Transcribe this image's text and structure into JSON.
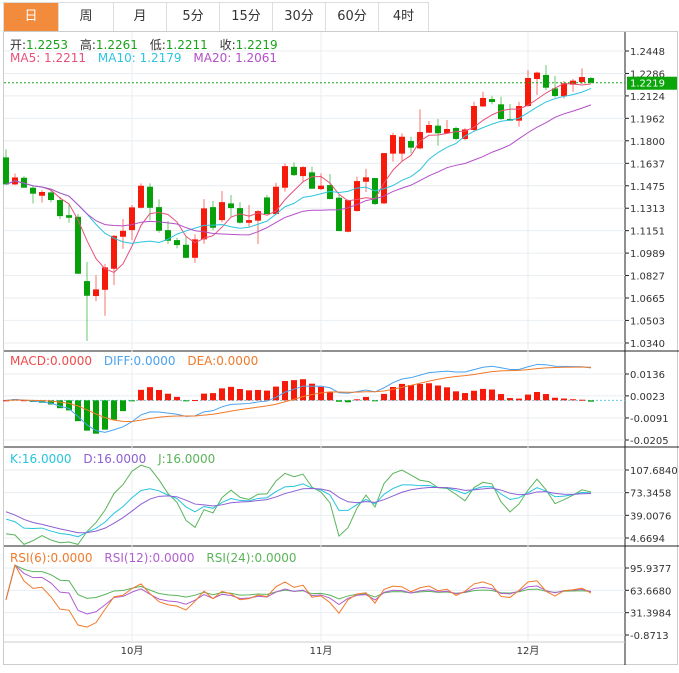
{
  "tabs": [
    {
      "label": "日",
      "active": true
    },
    {
      "label": "周"
    },
    {
      "label": "月"
    },
    {
      "label": "5分"
    },
    {
      "label": "15分"
    },
    {
      "label": "30分"
    },
    {
      "label": "60分"
    },
    {
      "label": "4时"
    }
  ],
  "ohlc_legend": {
    "open_label": "开:",
    "open": "1.2253",
    "high_label": "高:",
    "high": "1.2261",
    "low_label": "低:",
    "low": "1.2211",
    "close_label": "收:",
    "close": "1.2219"
  },
  "ma_legend": {
    "ma5": "MA5: 1.2211",
    "ma10": "MA10: 1.2179",
    "ma20": "MA20: 1.2061"
  },
  "macd_legend": {
    "macd": "MACD:0.0000",
    "diff": "DIFF:0.0000",
    "dea": "DEA:0.0000"
  },
  "kdj_legend": {
    "k": "K:16.0000",
    "d": "D:16.0000",
    "j": "J:16.0000"
  },
  "rsi_legend": {
    "rsi6": "RSI(6):0.0000",
    "rsi12": "RSI(12):0.0000",
    "rsi24": "RSI(24):0.0000"
  },
  "colors": {
    "up": "#f51a0a",
    "down": "#06a10a",
    "ma5": "#e8507a",
    "ma10": "#2ec4e0",
    "ma20": "#b44fc8",
    "diff": "#4aa3f0",
    "dea": "#f07a2a",
    "k": "#27c4dd",
    "d": "#8d5fd3",
    "j": "#5ab55a",
    "rsi6": "#f07a2a",
    "rsi12": "#b05fd0",
    "rsi24": "#5ab55a",
    "accent": "#f28b3c"
  },
  "chart_data": {
    "type": "candlestick",
    "ohlc_format": [
      "open",
      "high",
      "low",
      "close"
    ],
    "ohlc": [
      [
        1.168,
        1.1738,
        1.1485,
        1.1485
      ],
      [
        1.1485,
        1.1564,
        1.148,
        1.1535
      ],
      [
        1.1533,
        1.1545,
        1.1461,
        1.1461
      ],
      [
        1.1461,
        1.148,
        1.1348,
        1.1418
      ],
      [
        1.1403,
        1.1444,
        1.1353,
        1.143
      ],
      [
        1.1427,
        1.1456,
        1.1355,
        1.1372
      ],
      [
        1.1372,
        1.1396,
        1.1235,
        1.1256
      ],
      [
        1.1263,
        1.1348,
        1.1208,
        1.1244
      ],
      [
        1.1251,
        1.1271,
        1.084,
        1.084
      ],
      [
        1.0787,
        1.0926,
        1.0354,
        1.0681
      ],
      [
        1.0679,
        1.083,
        1.0642,
        1.0727
      ],
      [
        1.0724,
        1.091,
        1.0537,
        1.0886
      ],
      [
        1.0876,
        1.1119,
        1.0758,
        1.1114
      ],
      [
        1.1107,
        1.1235,
        1.102,
        1.115
      ],
      [
        1.1155,
        1.1336,
        1.1083,
        1.1319
      ],
      [
        1.1316,
        1.1492,
        1.1312,
        1.1475
      ],
      [
        1.1468,
        1.1492,
        1.1227,
        1.1316
      ],
      [
        1.1321,
        1.1377,
        1.1136,
        1.115
      ],
      [
        1.1155,
        1.122,
        1.1054,
        1.1078
      ],
      [
        1.1083,
        1.11,
        1.1023,
        1.1047
      ],
      [
        1.1049,
        1.1107,
        1.0951,
        1.0955
      ],
      [
        1.0955,
        1.1124,
        1.0919,
        1.1088
      ],
      [
        1.1088,
        1.1379,
        1.1056,
        1.1312
      ],
      [
        1.1321,
        1.1365,
        1.1155,
        1.1172
      ],
      [
        1.1227,
        1.1437,
        1.1211,
        1.1357
      ],
      [
        1.1348,
        1.1408,
        1.1247,
        1.1314
      ],
      [
        1.1314,
        1.1357,
        1.1203,
        1.1208
      ],
      [
        1.1208,
        1.1336,
        1.1179,
        1.1227
      ],
      [
        1.1223,
        1.13,
        1.1056,
        1.1292
      ],
      [
        1.1391,
        1.1408,
        1.1271,
        1.1271
      ],
      [
        1.1271,
        1.1497,
        1.1263,
        1.1468
      ],
      [
        1.1461,
        1.1637,
        1.1432,
        1.1617
      ],
      [
        1.1612,
        1.1644,
        1.1545,
        1.1552
      ],
      [
        1.1545,
        1.1617,
        1.1504,
        1.161
      ],
      [
        1.1572,
        1.1613,
        1.1454,
        1.1454
      ],
      [
        1.1451,
        1.1565,
        1.1444,
        1.1476
      ],
      [
        1.148,
        1.156,
        1.1379,
        1.1379
      ],
      [
        1.1389,
        1.1408,
        1.1148,
        1.1148
      ],
      [
        1.1143,
        1.1377,
        1.1139,
        1.1372
      ],
      [
        1.1293,
        1.1541,
        1.1288,
        1.1509
      ],
      [
        1.1504,
        1.1598,
        1.143,
        1.1536
      ],
      [
        1.1531,
        1.1531,
        1.1336,
        1.1343
      ],
      [
        1.1348,
        1.1711,
        1.1343,
        1.1711
      ],
      [
        1.1707,
        1.1858,
        1.1649,
        1.1841
      ],
      [
        1.1707,
        1.1854,
        1.1649,
        1.1829
      ],
      [
        1.1798,
        1.1829,
        1.1709,
        1.175
      ],
      [
        1.1745,
        1.2027,
        1.1738,
        1.1863
      ],
      [
        1.1858,
        1.1943,
        1.1854,
        1.1914
      ],
      [
        1.1909,
        1.1957,
        1.1764,
        1.1854
      ],
      [
        1.1854,
        1.195,
        1.1849,
        1.1885
      ],
      [
        1.1892,
        1.1902,
        1.1805,
        1.1813
      ],
      [
        1.1813,
        1.189,
        1.1805,
        1.1882
      ],
      [
        1.1878,
        1.2082,
        1.187,
        1.2051
      ],
      [
        1.2048,
        1.2154,
        1.2044,
        1.2109
      ],
      [
        1.2101,
        1.2125,
        1.2063,
        1.208
      ],
      [
        1.2063,
        1.2118,
        1.195,
        1.1957
      ],
      [
        1.1957,
        1.2065,
        1.1945,
        1.1945
      ],
      [
        1.1945,
        1.2082,
        1.1902,
        1.2051
      ],
      [
        1.2051,
        1.2311,
        1.2046,
        1.2253
      ],
      [
        1.2246,
        1.2299,
        1.213,
        1.2292
      ],
      [
        1.2275,
        1.2347,
        1.2166,
        1.2183
      ],
      [
        1.2178,
        1.2268,
        1.2113,
        1.2123
      ],
      [
        1.2123,
        1.2231,
        1.2106,
        1.2215
      ],
      [
        1.2205,
        1.2246,
        1.2154,
        1.2234
      ],
      [
        1.2224,
        1.2323,
        1.221,
        1.226
      ],
      [
        1.2253,
        1.2261,
        1.2211,
        1.2219
      ]
    ],
    "price_ticks": [
      "1.2448",
      "1.2286",
      "1.2124",
      "1.1962",
      "1.1800",
      "1.1637",
      "1.1475",
      "1.1313",
      "1.1151",
      "1.0989",
      "1.0827",
      "1.0665",
      "1.0503",
      "1.0340"
    ],
    "ylim": [
      1.034,
      1.2448
    ],
    "last_price": "1.2219",
    "month_ticks": [
      {
        "label": "10月",
        "index": 14
      },
      {
        "label": "11月",
        "index": 35
      },
      {
        "label": "12月",
        "index": 58
      }
    ],
    "macd_ticks": [
      "0.0136",
      "0.0023",
      "-0.0091",
      "-0.0205"
    ],
    "kdj_ticks": [
      "107.6840",
      "73.3458",
      "39.0076",
      "4.6694"
    ],
    "rsi_ticks": [
      "95.9377",
      "63.6680",
      "31.3984",
      "-0.8713"
    ],
    "grid": true
  }
}
